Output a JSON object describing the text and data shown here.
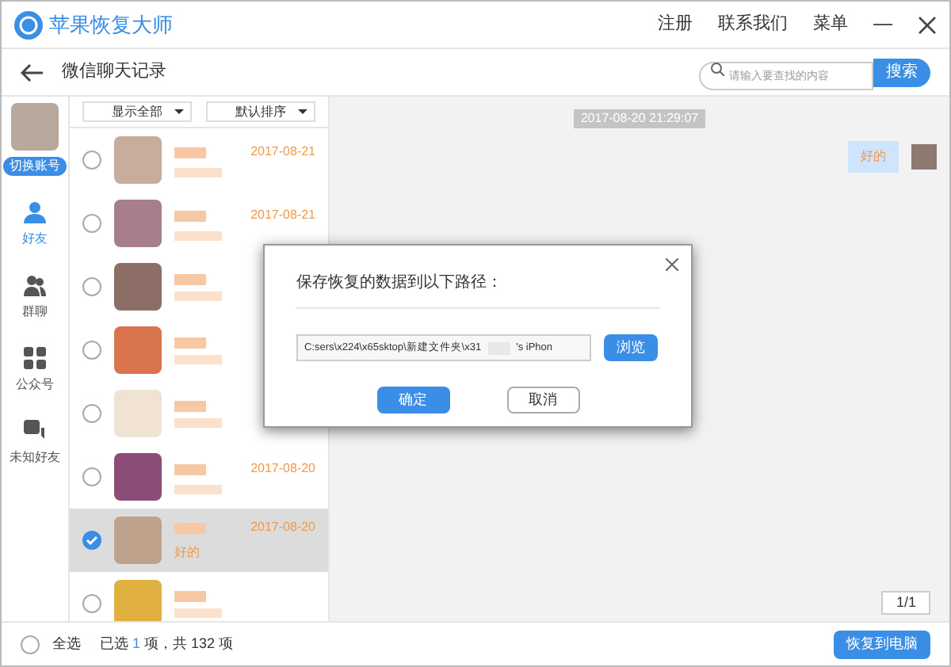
{
  "window": {
    "title": "苹果恢复大师",
    "menu": [
      "注册",
      "联系我们",
      "菜单"
    ]
  },
  "toolbar": {
    "back_label": "微信聊天记录",
    "search": {
      "placeholder": "请输入要查找的内容"
    },
    "search_button": "搜索"
  },
  "account": {
    "switch_label": "切换账号"
  },
  "nav": [
    {
      "kind": "friend",
      "label": "好友",
      "selected": true
    },
    {
      "kind": "group",
      "label": "群聊",
      "selected": false
    },
    {
      "kind": "official",
      "label": "公众号",
      "selected": false
    },
    {
      "kind": "unknown",
      "label": "未知好友",
      "selected": false
    }
  ],
  "filters": [
    "显示全部",
    "默认排序"
  ],
  "contacts": [
    {
      "date": "2017-08-21",
      "checked": false,
      "selected": false
    },
    {
      "date": "2017-08-21",
      "checked": false,
      "selected": false
    },
    {
      "checked": false,
      "selected": false
    },
    {
      "checked": false,
      "selected": false
    },
    {
      "checked": false,
      "selected": false
    },
    {
      "date": "2017-08-20",
      "checked": false,
      "selected": false
    },
    {
      "date": "2017-08-20",
      "preview": "好的",
      "checked": true,
      "selected": true
    },
    {
      "checked": false,
      "selected": false
    }
  ],
  "chat": {
    "timestamp": "2017-08-20 21:29:07",
    "messages": [
      {
        "text": "好的"
      }
    ],
    "pager": "1/1"
  },
  "dialog": {
    "title": "保存恢复的数据到以下路径：",
    "path": "C:sers\\x224\\x65sktop\\新建文件夹\\x31",
    "path_suffix": "'s iPhon",
    "browse": "浏览",
    "ok": "确定",
    "cancel": "取消"
  },
  "status_bar": {
    "select_all": "全选",
    "select_all_checked": false,
    "selected_prefix": "已选",
    "selected_count": "1",
    "selected_suffix": "项，共 132 项",
    "recover_button": "恢复到电脑"
  }
}
